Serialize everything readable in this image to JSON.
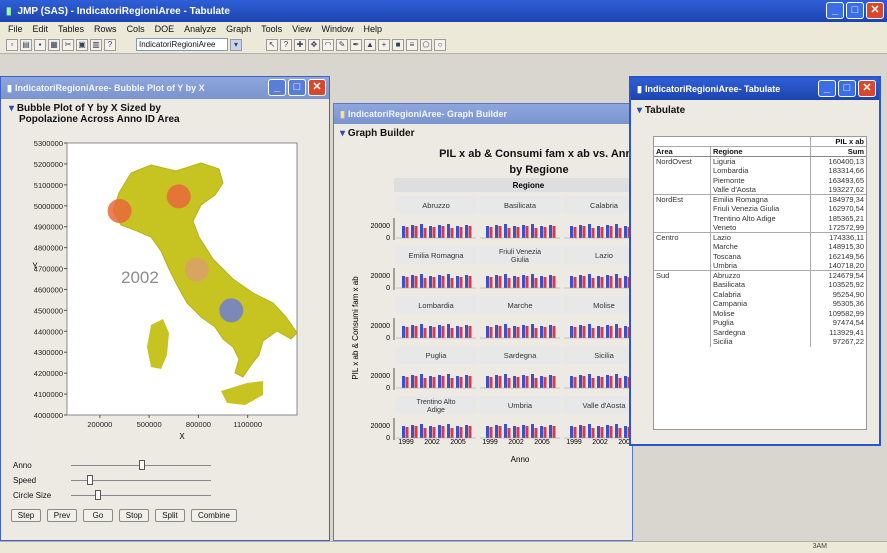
{
  "app": {
    "title": "JMP (SAS) - IndicatoriRegioniAree - Tabulate"
  },
  "menu": [
    "File",
    "Edit",
    "Tables",
    "Rows",
    "Cols",
    "DOE",
    "Analyze",
    "Graph",
    "Tools",
    "View",
    "Window",
    "Help"
  ],
  "toolbar": {
    "table_select": "IndicatoriRegioniAree"
  },
  "bubble_window": {
    "title": "IndicatoriRegioniAree- Bubble Plot of Y by X",
    "heading_line1": "Bubble Plot of Y by X Sized by",
    "heading_line2": "Popolazione Across Anno ID Area",
    "year_label": "2002",
    "xlabel": "X",
    "ylabel": "Y",
    "y_ticks": [
      "5300000",
      "5200000",
      "5100000",
      "5000000",
      "4900000",
      "4800000",
      "4700000",
      "4600000",
      "4500000",
      "4400000",
      "4300000",
      "4200000",
      "4100000",
      "4000000"
    ],
    "x_ticks": [
      "200000",
      "500000",
      "800000",
      "1100000"
    ],
    "controls": {
      "anno": "Anno",
      "speed": "Speed",
      "circle_size": "Circle Size"
    },
    "buttons": [
      "Step",
      "Prev",
      "Go",
      "Stop",
      "Split",
      "Combine"
    ],
    "bubbles": [
      {
        "x": 320000,
        "y": 4975000,
        "color": "#e8683a"
      },
      {
        "x": 680000,
        "y": 5045000,
        "color": "#e8683a"
      },
      {
        "x": 790000,
        "y": 4695000,
        "color": "#d9a06a"
      },
      {
        "x": 1000000,
        "y": 4500000,
        "color": "#6f7fd2"
      }
    ]
  },
  "graph_window": {
    "title": "IndicatoriRegioniAree- Graph Builder",
    "heading": "Graph Builder",
    "chart_title_line1": "PIL x ab & Consumi fam x ab vs. Anno",
    "chart_title_line2": "by Regione",
    "group_header": "Regione",
    "ylabel": "PIL x ab & Consumi fam x ab",
    "xlabel": "Anno",
    "ytick": "20000",
    "yzero": "0",
    "x_ticks": [
      "1999",
      "2002",
      "2005"
    ],
    "rows": [
      [
        "Abruzzo",
        "Basilicata",
        "Calabria"
      ],
      [
        "Emilia Romagna",
        "Friuli Venezia Giulia",
        "Lazio"
      ],
      [
        "Lombardia",
        "Marche",
        "Molise"
      ],
      [
        "Puglia",
        "Sardegna",
        "Sicilia"
      ],
      [
        "Trentino Alto Adige",
        "Umbria",
        "Valle d'Aosta"
      ]
    ]
  },
  "tabulate_window": {
    "title": "IndicatoriRegioniAree- Tabulate",
    "heading": "Tabulate",
    "col_header_1": "PIL x ab",
    "col_header_2": "Sum",
    "col_area": "Area",
    "col_regione": "Regione",
    "rows": [
      {
        "area": "NordOvest",
        "regione": "Liguria",
        "value": "160400,13"
      },
      {
        "area": "",
        "regione": "Lombardia",
        "value": "183314,66"
      },
      {
        "area": "",
        "regione": "Piemonte",
        "value": "163493,65"
      },
      {
        "area": "",
        "regione": "Valle d'Aosta",
        "value": "193227,62"
      },
      {
        "area": "NordEst",
        "regione": "Emilia Romagna",
        "value": "184979,34"
      },
      {
        "area": "",
        "regione": "Friuli Venezia Giulia",
        "value": "162970,54"
      },
      {
        "area": "",
        "regione": "Trentino Alto Adige",
        "value": "185365,21"
      },
      {
        "area": "",
        "regione": "Veneto",
        "value": "172572,99"
      },
      {
        "area": "Centro",
        "regione": "Lazio",
        "value": "174336,11"
      },
      {
        "area": "",
        "regione": "Marche",
        "value": "148915,30"
      },
      {
        "area": "",
        "regione": "Toscana",
        "value": "162149,56"
      },
      {
        "area": "",
        "regione": "Umbria",
        "value": "140718,20"
      },
      {
        "area": "Sud",
        "regione": "Abruzzo",
        "value": "124679,54"
      },
      {
        "area": "",
        "regione": "Basilicata",
        "value": "103525,92"
      },
      {
        "area": "",
        "regione": "Calabria",
        "value": "95254,90"
      },
      {
        "area": "",
        "regione": "Campania",
        "value": "95305,36"
      },
      {
        "area": "",
        "regione": "Molise",
        "value": "109582,99"
      },
      {
        "area": "",
        "regione": "Puglia",
        "value": "97474,54"
      },
      {
        "area": "",
        "regione": "Sardegna",
        "value": "113929,41"
      },
      {
        "area": "",
        "regione": "Sicilia",
        "value": "97267,22"
      }
    ]
  },
  "statusbar": {
    "right_text": "3AM"
  },
  "colors": {
    "bar_blue": "#3a52c8",
    "bar_red": "#d63a52",
    "italy_fill": "#c7c421"
  }
}
